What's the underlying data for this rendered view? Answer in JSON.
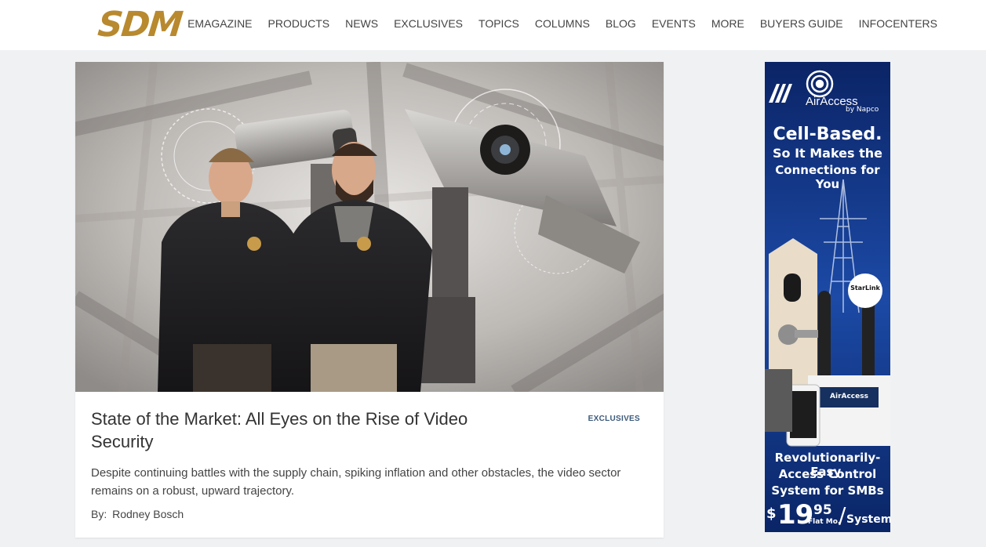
{
  "header": {
    "logo": "SDM",
    "nav": [
      "EMAGAZINE",
      "PRODUCTS",
      "NEWS",
      "EXCLUSIVES",
      "TOPICS",
      "COLUMNS",
      "BLOG",
      "EVENTS",
      "MORE",
      "BUYERS GUIDE",
      "INFOCENTERS"
    ]
  },
  "article": {
    "title": "State of the Market: All Eyes on the Rise of Video Security",
    "category": "EXCLUSIVES",
    "description": "Despite continuing battles with the supply chain, spiking inflation and other obstacles, the video sector remains on a robust, upward trajectory.",
    "byline_label": "By:",
    "author": "Rodney Bosch"
  },
  "ad": {
    "brand": "AirAccess",
    "brand_sub": "by Napco",
    "headline_1": "Cell-Based.",
    "headline_2": "So It Makes the",
    "headline_3": "Connections for You",
    "badge": "StarLink",
    "device_label": "AirAccess",
    "tagline_1": "Revolutionarily-Easy,",
    "tagline_2": "Access Control",
    "tagline_3": "System for SMBs",
    "price_symbol": "$",
    "price_main": "19",
    "price_cents": "95",
    "price_unit": "Flat Mo.",
    "price_suffix": "System",
    "colors": {
      "bg": "#0d2a6e",
      "accent": "#ffffff"
    }
  }
}
